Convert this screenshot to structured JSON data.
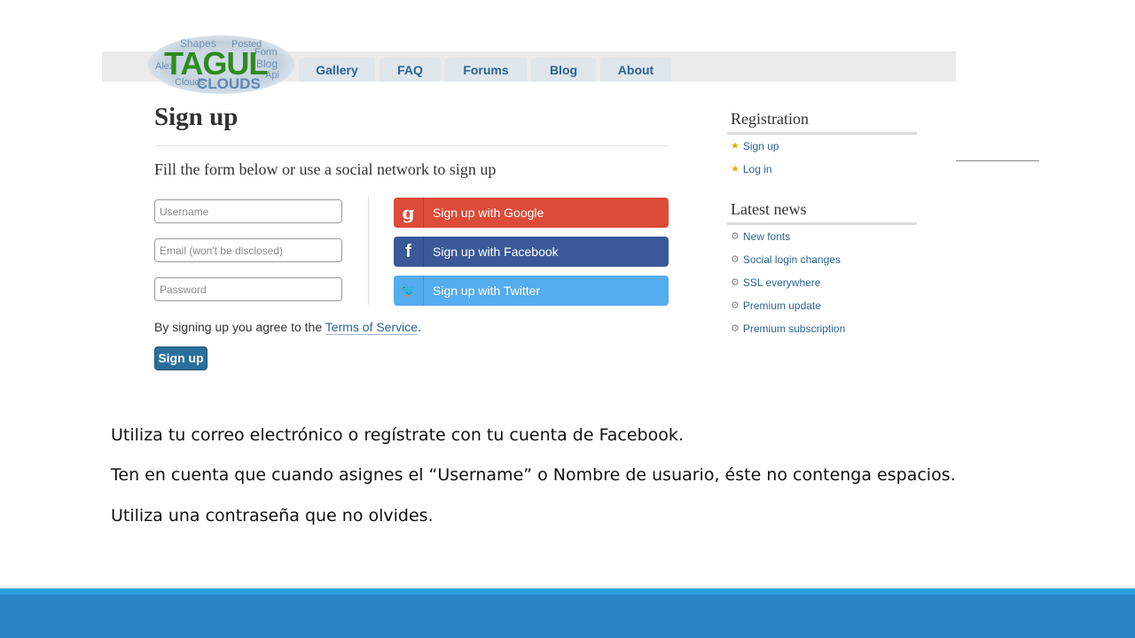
{
  "logo": {
    "main": "TAGUL",
    "sub": "CLOUDS",
    "words": [
      "Shapes",
      "Alex",
      "Posted",
      "Blog",
      "Api",
      "Form",
      "Font",
      "Clouds",
      "Page"
    ]
  },
  "nav": {
    "tabs": [
      "Gallery",
      "FAQ",
      "Forums",
      "Blog",
      "About"
    ]
  },
  "form": {
    "title": "Sign up",
    "lead": "Fill the form below or use a social network to sign up",
    "username_placeholder": "Username",
    "email_placeholder": "Email (won't be disclosed)",
    "password_placeholder": "Password",
    "terms_prefix": "By signing up you agree to the ",
    "terms_link": "Terms of Service",
    "terms_suffix": ".",
    "submit_label": "Sign up"
  },
  "social": [
    {
      "icon": "google-icon",
      "glyph": "g",
      "label": "Sign up with Google",
      "color": "#dd4b39"
    },
    {
      "icon": "facebook-icon",
      "glyph": "f",
      "label": "Sign up with Facebook",
      "color": "#3b5998"
    },
    {
      "icon": "twitter-icon",
      "glyph": "🐦",
      "label": "Sign up with Twitter",
      "color": "#55acee"
    }
  ],
  "sidebar": {
    "registration_title": "Registration",
    "registration_items": [
      "Sign up",
      "Log in"
    ],
    "news_title": "Latest news",
    "news_items": [
      "New fonts",
      "Social login changes",
      "SSL everywhere",
      "Premium update",
      "Premium subscription"
    ]
  },
  "captions": [
    "Utiliza tu correo electrónico o regístrate con tu cuenta de Facebook.",
    "Ten en cuenta que cuando asignes el “Username” o Nombre de usuario, éste no contenga espacios.",
    "Utiliza una contraseña que no olvides."
  ],
  "colors": {
    "accent_light": "#2aa1dc",
    "accent_dark": "#2a84c6",
    "link": "#2a6496",
    "logo_green": "#2e8b1e"
  }
}
